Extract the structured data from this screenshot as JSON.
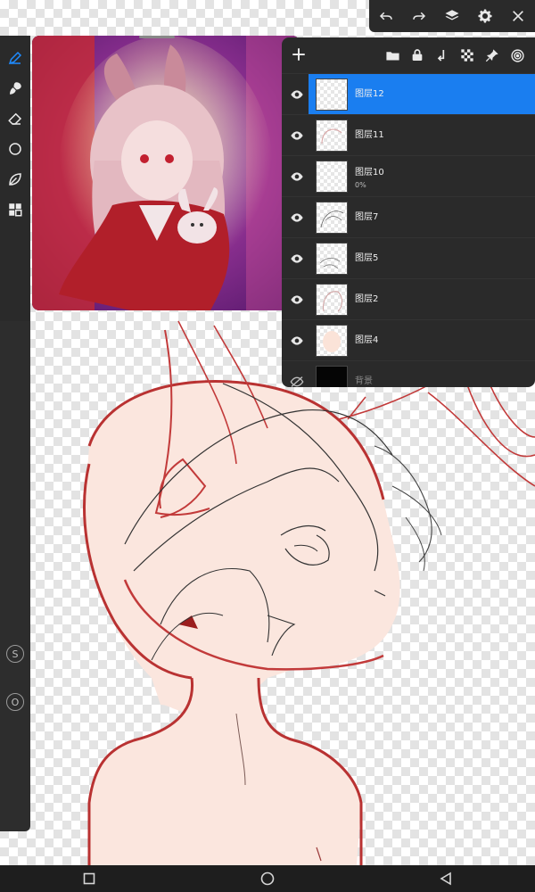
{
  "layers": [
    {
      "name": "图层12",
      "sub": "",
      "selected": true,
      "visible": true
    },
    {
      "name": "图层11",
      "sub": "",
      "selected": false,
      "visible": true
    },
    {
      "name": "图层10",
      "sub": "0%",
      "selected": false,
      "visible": true
    },
    {
      "name": "图层7",
      "sub": "",
      "selected": false,
      "visible": true
    },
    {
      "name": "图层5",
      "sub": "",
      "selected": false,
      "visible": true
    },
    {
      "name": "图层2",
      "sub": "",
      "selected": false,
      "visible": true
    },
    {
      "name": "图层4",
      "sub": "",
      "selected": false,
      "visible": true
    },
    {
      "name": "背景",
      "sub": "",
      "selected": false,
      "visible": false
    }
  ],
  "left_rail": {
    "s_label": "S",
    "o_label": "O"
  },
  "colors": {
    "accent": "#1a7ef0",
    "panel": "#2a2a2a",
    "sketch_red": "#c23a3a",
    "skin": "#fbe6de"
  },
  "icons": {
    "top_toolbar": [
      "undo-icon",
      "redo-icon",
      "layers-icon",
      "gear-icon",
      "close-icon"
    ],
    "left_tools": [
      "pen-icon",
      "brush-icon",
      "eraser-icon",
      "circle-icon",
      "leaf-icon",
      "grid-icon"
    ],
    "layers_header": [
      "add-icon",
      "folder-icon",
      "lock-icon",
      "merge-down-icon",
      "checker-icon",
      "pin-icon",
      "target-icon"
    ],
    "navbar": [
      "square-icon",
      "circle-icon",
      "back-triangle-icon"
    ]
  }
}
